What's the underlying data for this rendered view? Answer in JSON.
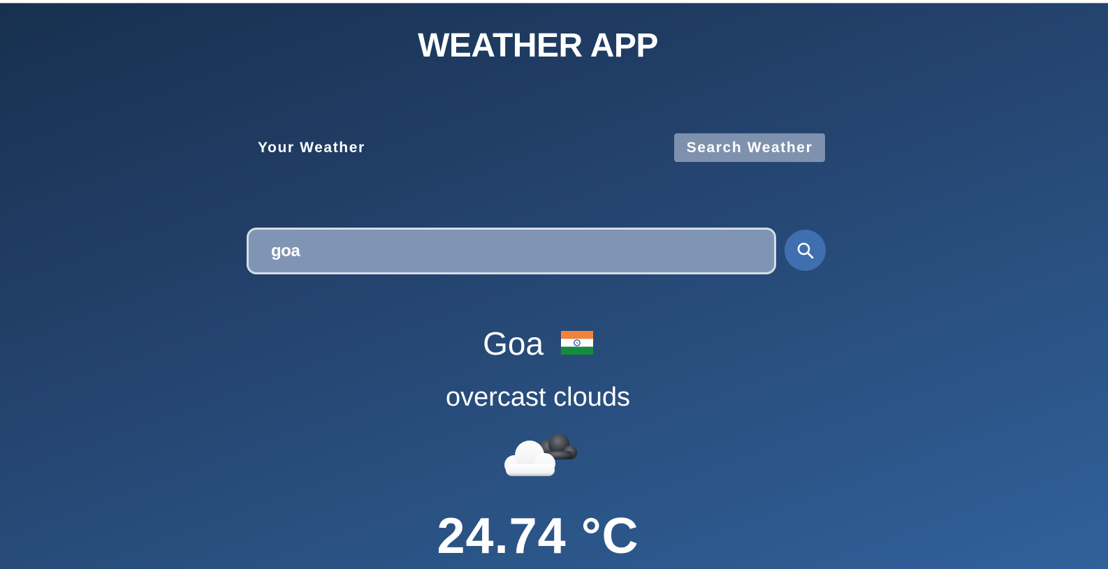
{
  "app": {
    "title": "WEATHER APP"
  },
  "tabs": [
    {
      "label": "Your Weather",
      "active": false
    },
    {
      "label": "Search Weather",
      "active": true
    }
  ],
  "search": {
    "value": "goa",
    "icon": "search-icon"
  },
  "weather": {
    "city": "Goa",
    "country_flag_icon": "india-flag-icon",
    "description": "overcast clouds",
    "condition_icon": "overcast-clouds-icon",
    "temperature": "24.74 °C"
  },
  "colors": {
    "background_top": "#17304f",
    "background_bottom": "#31609a",
    "search_button": "#3f6fae",
    "input_fill": "#8095b3",
    "active_tab": "#8a9ab3"
  }
}
